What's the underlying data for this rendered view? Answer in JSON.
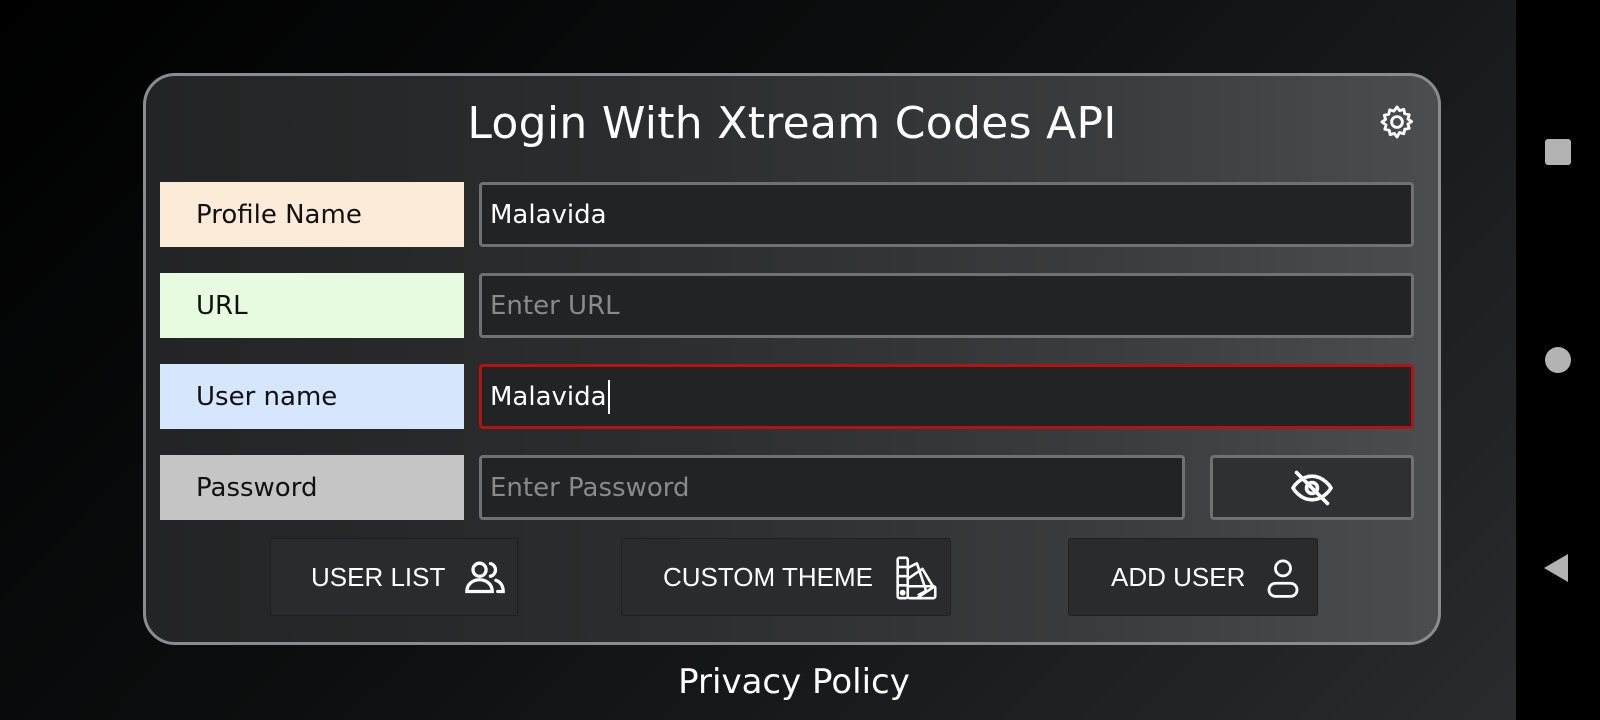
{
  "title": "Login With Xtream Codes API",
  "form": {
    "profile_name": {
      "label": "Profile Name",
      "value": "Malavida",
      "label_color": "#fdebd9"
    },
    "url": {
      "label": "URL",
      "placeholder": "Enter URL",
      "label_color": "#e7fbe0"
    },
    "user_name": {
      "label": "User name",
      "value": "Malavida",
      "label_color": "#d6e6fd"
    },
    "password": {
      "label": "Password",
      "placeholder": "Enter Password",
      "label_color": "#c5c5c5"
    }
  },
  "actions": {
    "user_list": {
      "label": "USER LIST",
      "icon": "users-icon"
    },
    "custom_theme": {
      "label": "CUSTOM THEME",
      "icon": "palette-swatch-icon"
    },
    "add_user": {
      "label": "ADD USER",
      "icon": "user-icon"
    }
  },
  "footer": {
    "privacy": "Privacy Policy"
  },
  "colors": {
    "focus_border": "#b51212",
    "field_border": "#6f7274"
  },
  "icons": {
    "settings": "gear-icon",
    "password_toggle": "eye-off-icon",
    "nav_recent": "square-icon",
    "nav_home": "circle-icon",
    "nav_back": "triangle-back-icon"
  }
}
